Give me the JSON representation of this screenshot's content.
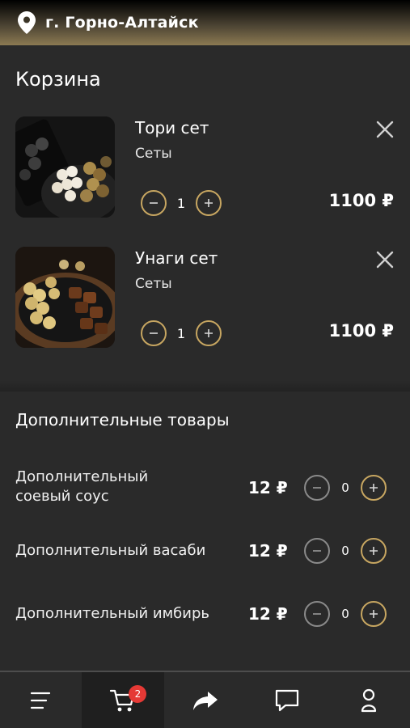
{
  "header": {
    "city": "г. Горно-Алтайск",
    "icon": "location-pin-icon"
  },
  "page_title": "Корзина",
  "cart": {
    "items": [
      {
        "name": "Тори сет",
        "category": "Сеты",
        "quantity": "1",
        "price": "1100 ₽"
      },
      {
        "name": "Унаги сет",
        "category": "Сеты",
        "quantity": "1",
        "price": "1100 ₽"
      }
    ]
  },
  "extras": {
    "title": "Дополнительные товары",
    "items": [
      {
        "label_line1": "Дополнительный",
        "label_line2": "соевый соус",
        "price": "12 ₽",
        "quantity": "0"
      },
      {
        "label_line1": "Дополнительный васаби",
        "label_line2": "",
        "price": "12 ₽",
        "quantity": "0"
      },
      {
        "label_line1": "Дополнительный имбирь",
        "label_line2": "",
        "price": "12 ₽",
        "quantity": "0"
      }
    ]
  },
  "bottom_nav": {
    "items": [
      {
        "icon": "menu-icon"
      },
      {
        "icon": "cart-icon",
        "badge": "2",
        "active": true
      },
      {
        "icon": "share-icon"
      },
      {
        "icon": "chat-icon"
      },
      {
        "icon": "profile-icon"
      }
    ]
  },
  "colors": {
    "accent": "#c7a661",
    "background": "#2a2a2a",
    "badge": "#e53935"
  }
}
